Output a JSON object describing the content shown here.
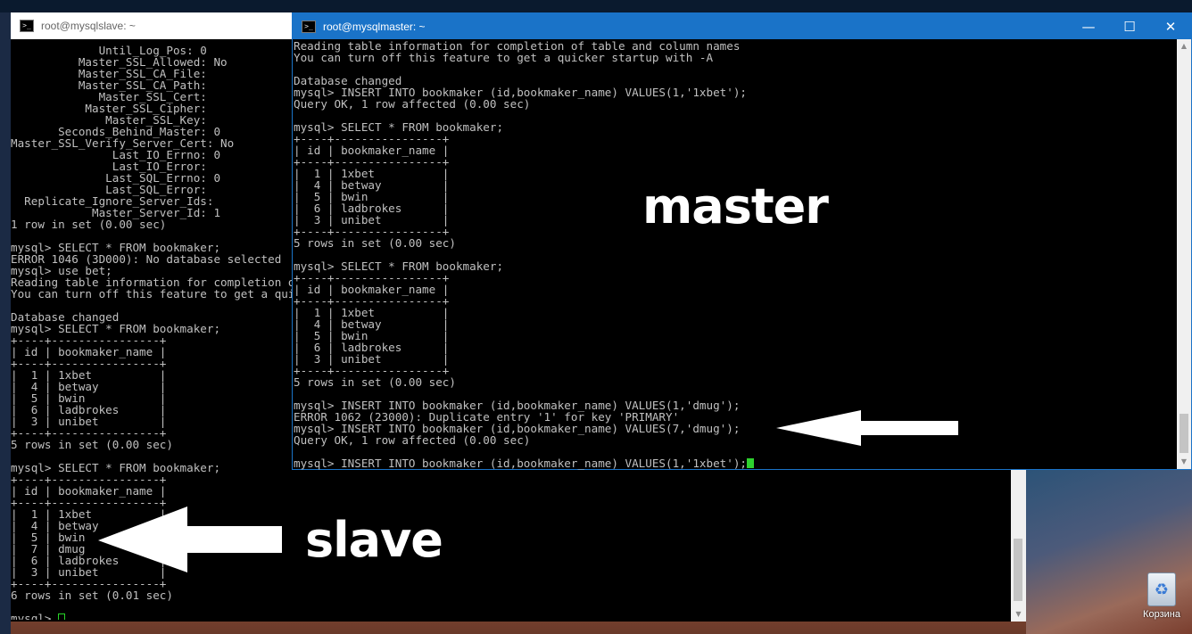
{
  "slave_window": {
    "title": "root@mysqlslave: ~",
    "lines": [
      "             Until_Log_Pos: 0",
      "          Master_SSL_Allowed: No",
      "          Master_SSL_CA_File:",
      "          Master_SSL_CA_Path:",
      "             Master_SSL_Cert:",
      "           Master_SSL_Cipher:",
      "              Master_SSL_Key:",
      "       Seconds_Behind_Master: 0",
      "Master_SSL_Verify_Server_Cert: No",
      "               Last_IO_Errno: 0",
      "               Last_IO_Error:",
      "              Last_SQL_Errno: 0",
      "              Last_SQL_Error:",
      "  Replicate_Ignore_Server_Ids:",
      "            Master_Server_Id: 1",
      "1 row in set (0.00 sec)",
      "",
      "mysql> SELECT * FROM bookmaker;",
      "ERROR 1046 (3D000): No database selected",
      "mysql> use bet;",
      "Reading table information for completion of table and column names",
      "You can turn off this feature to get a quicker startup with -A",
      "",
      "Database changed",
      "mysql> SELECT * FROM bookmaker;",
      "+----+----------------+",
      "| id | bookmaker_name |",
      "+----+----------------+",
      "|  1 | 1xbet          |",
      "|  4 | betway         |",
      "|  5 | bwin           |",
      "|  6 | ladbrokes      |",
      "|  3 | unibet         |",
      "+----+----------------+",
      "5 rows in set (0.00 sec)",
      "",
      "mysql> SELECT * FROM bookmaker;",
      "+----+----------------+",
      "| id | bookmaker_name |",
      "+----+----------------+",
      "|  1 | 1xbet          |",
      "|  4 | betway         |",
      "|  5 | bwin           |",
      "|  7 | dmug           |",
      "|  6 | ladbrokes      |",
      "|  3 | unibet         |",
      "+----+----------------+",
      "6 rows in set (0.01 sec)",
      ""
    ],
    "prompt": "mysql> "
  },
  "master_window": {
    "title": "root@mysqlmaster: ~",
    "controls": {
      "minimize": "—",
      "maximize": "☐",
      "close": "✕"
    },
    "lines": [
      "Reading table information for completion of table and column names",
      "You can turn off this feature to get a quicker startup with -A",
      "",
      "Database changed",
      "mysql> INSERT INTO bookmaker (id,bookmaker_name) VALUES(1,'1xbet');",
      "Query OK, 1 row affected (0.00 sec)",
      "",
      "mysql> SELECT * FROM bookmaker;",
      "+----+----------------+",
      "| id | bookmaker_name |",
      "+----+----------------+",
      "|  1 | 1xbet          |",
      "|  4 | betway         |",
      "|  5 | bwin           |",
      "|  6 | ladbrokes      |",
      "|  3 | unibet         |",
      "+----+----------------+",
      "5 rows in set (0.00 sec)",
      "",
      "mysql> SELECT * FROM bookmaker;",
      "+----+----------------+",
      "| id | bookmaker_name |",
      "+----+----------------+",
      "|  1 | 1xbet          |",
      "|  4 | betway         |",
      "|  5 | bwin           |",
      "|  6 | ladbrokes      |",
      "|  3 | unibet         |",
      "+----+----------------+",
      "5 rows in set (0.00 sec)",
      "",
      "mysql> INSERT INTO bookmaker (id,bookmaker_name) VALUES(1,'dmug');",
      "ERROR 1062 (23000): Duplicate entry '1' for key 'PRIMARY'",
      "mysql> INSERT INTO bookmaker (id,bookmaker_name) VALUES(7,'dmug');",
      "Query OK, 1 row affected (0.00 sec)",
      ""
    ],
    "prompt": "mysql> INSERT INTO bookmaker (id,bookmaker_name) VALUES(1,'1xbet');"
  },
  "annotations": {
    "master_label": "master",
    "slave_label": "slave"
  },
  "desktop": {
    "recycle_bin_label": "Корзина"
  }
}
